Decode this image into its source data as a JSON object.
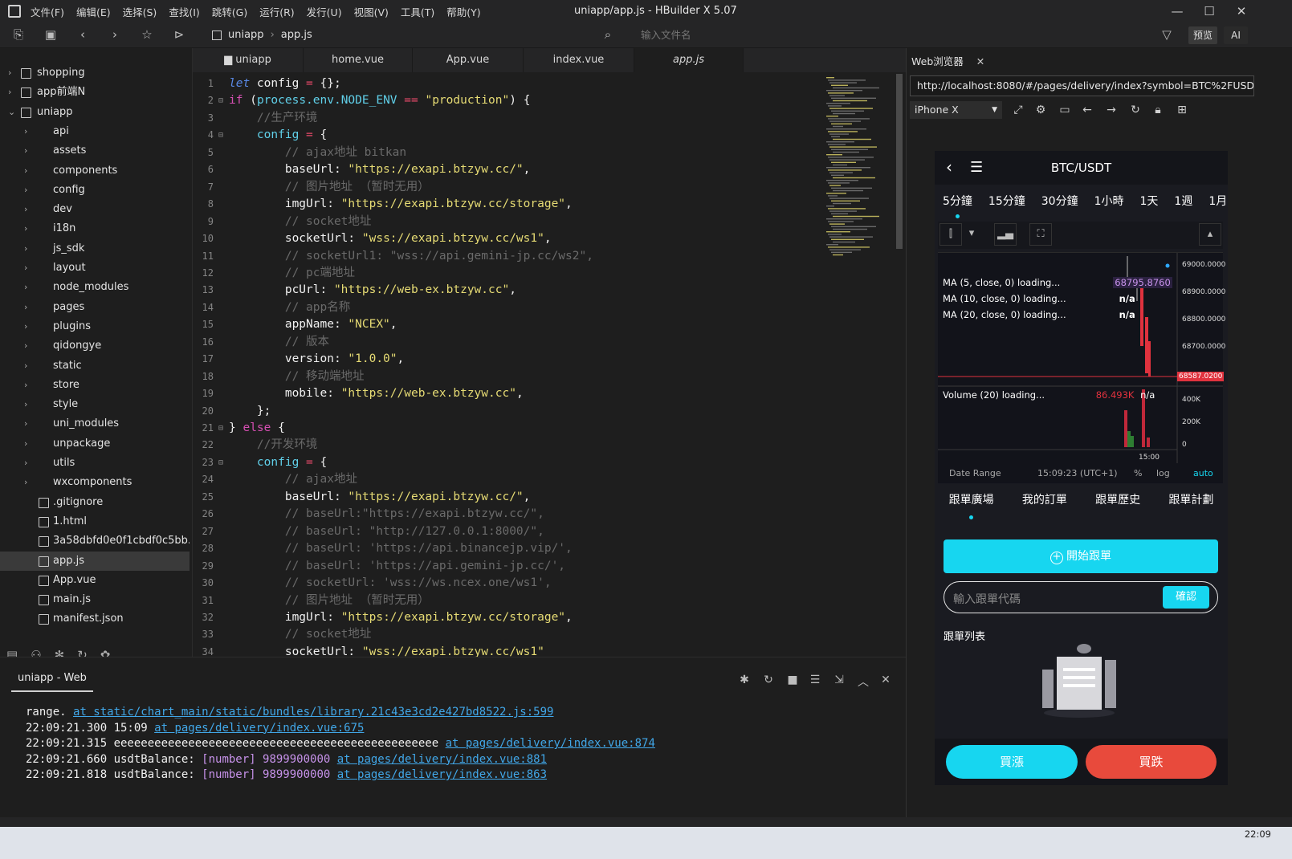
{
  "window": {
    "title": "uniapp/app.js - HBuilder X 5.07",
    "menu": [
      "文件(F)",
      "编辑(E)",
      "选择(S)",
      "查找(I)",
      "跳转(G)",
      "运行(R)",
      "发行(U)",
      "视图(V)",
      "工具(T)",
      "帮助(Y)"
    ]
  },
  "toolbar": {
    "breadcrumb": [
      "uniapp",
      "app.js"
    ],
    "file_search_placeholder": "输入文件名",
    "preview_label": "预览",
    "ai_label": "AI"
  },
  "sidebar": {
    "items": [
      {
        "label": "shopping",
        "type": "project"
      },
      {
        "label": "app前端N",
        "type": "project"
      },
      {
        "label": "uniapp",
        "type": "project"
      },
      {
        "label": "api",
        "type": "folder"
      },
      {
        "label": "assets",
        "type": "folder"
      },
      {
        "label": "components",
        "type": "folder"
      },
      {
        "label": "config",
        "type": "folder"
      },
      {
        "label": "dev",
        "type": "folder"
      },
      {
        "label": "i18n",
        "type": "folder"
      },
      {
        "label": "js_sdk",
        "type": "folder"
      },
      {
        "label": "layout",
        "type": "folder"
      },
      {
        "label": "node_modules",
        "type": "folder"
      },
      {
        "label": "pages",
        "type": "folder"
      },
      {
        "label": "plugins",
        "type": "folder"
      },
      {
        "label": "qidongye",
        "type": "folder"
      },
      {
        "label": "static",
        "type": "folder"
      },
      {
        "label": "store",
        "type": "folder"
      },
      {
        "label": "style",
        "type": "folder"
      },
      {
        "label": "uni_modules",
        "type": "folder"
      },
      {
        "label": "unpackage",
        "type": "folder"
      },
      {
        "label": "utils",
        "type": "folder"
      },
      {
        "label": "wxcomponents",
        "type": "folder"
      },
      {
        "label": ".gitignore",
        "type": "file"
      },
      {
        "label": "1.html",
        "type": "html"
      },
      {
        "label": "3a58dbfd0e0f1cbdf0c5bb...",
        "type": "file"
      },
      {
        "label": "app.js",
        "type": "file"
      },
      {
        "label": "App.vue",
        "type": "file"
      },
      {
        "label": "main.js",
        "type": "file"
      },
      {
        "label": "manifest.json",
        "type": "json"
      }
    ]
  },
  "tabs": [
    "uniapp",
    "home.vue",
    "App.vue",
    "index.vue",
    "app.js"
  ],
  "code_lines": [
    {
      "n": "1",
      "fold": "",
      "parts": [
        [
          "kwi",
          "let "
        ],
        [
          "pl",
          "config "
        ],
        [
          "op",
          "= "
        ],
        [
          "pl",
          "{};"
        ]
      ]
    },
    {
      "n": "2",
      "fold": "⊟",
      "parts": [
        [
          "kw",
          "if "
        ],
        [
          "pl",
          "("
        ],
        [
          "cy",
          "process.env.NODE_ENV "
        ],
        [
          "op",
          "== "
        ],
        [
          "str",
          "\"production\""
        ],
        [
          "pl",
          ") {"
        ]
      ]
    },
    {
      "n": "3",
      "fold": "",
      "parts": [
        [
          "cmt",
          "    //生产环境"
        ]
      ]
    },
    {
      "n": "4",
      "fold": "⊟",
      "parts": [
        [
          "pl",
          "    "
        ],
        [
          "cy",
          "config "
        ],
        [
          "op",
          "= "
        ],
        [
          "pl",
          "{"
        ]
      ]
    },
    {
      "n": "5",
      "fold": "",
      "parts": [
        [
          "cmt",
          "        // ajax地址 bitkan"
        ]
      ]
    },
    {
      "n": "6",
      "fold": "",
      "parts": [
        [
          "prop",
          "        baseUrl: "
        ],
        [
          "str",
          "\"https://exapi.btzyw.cc/\""
        ],
        [
          "pl",
          ","
        ]
      ]
    },
    {
      "n": "7",
      "fold": "",
      "parts": [
        [
          "cmt",
          "        // 图片地址 （暂时无用）"
        ]
      ]
    },
    {
      "n": "8",
      "fold": "",
      "parts": [
        [
          "prop",
          "        imgUrl: "
        ],
        [
          "str",
          "\"https://exapi.btzyw.cc/storage\""
        ],
        [
          "pl",
          ","
        ]
      ]
    },
    {
      "n": "9",
      "fold": "",
      "parts": [
        [
          "cmt",
          "        // socket地址"
        ]
      ]
    },
    {
      "n": "10",
      "fold": "",
      "parts": [
        [
          "prop",
          "        socketUrl: "
        ],
        [
          "str",
          "\"wss://exapi.btzyw.cc/ws1\""
        ],
        [
          "pl",
          ","
        ]
      ]
    },
    {
      "n": "11",
      "fold": "",
      "parts": [
        [
          "cmt",
          "        // socketUrl1: \"wss://api.gemini-jp.cc/ws2\","
        ]
      ]
    },
    {
      "n": "12",
      "fold": "",
      "parts": [
        [
          "cmt",
          "        // pc端地址"
        ]
      ]
    },
    {
      "n": "13",
      "fold": "",
      "parts": [
        [
          "prop",
          "        pcUrl: "
        ],
        [
          "str",
          "\"https://web-ex.btzyw.cc\""
        ],
        [
          "pl",
          ","
        ]
      ]
    },
    {
      "n": "14",
      "fold": "",
      "parts": [
        [
          "cmt",
          "        // app名称"
        ]
      ]
    },
    {
      "n": "15",
      "fold": "",
      "parts": [
        [
          "prop",
          "        appName: "
        ],
        [
          "str",
          "\"NCEX\""
        ],
        [
          "pl",
          ","
        ]
      ]
    },
    {
      "n": "16",
      "fold": "",
      "parts": [
        [
          "cmt",
          "        // 版本"
        ]
      ]
    },
    {
      "n": "17",
      "fold": "",
      "parts": [
        [
          "prop",
          "        version: "
        ],
        [
          "str",
          "\"1.0.0\""
        ],
        [
          "pl",
          ","
        ]
      ]
    },
    {
      "n": "18",
      "fold": "",
      "parts": [
        [
          "cmt",
          "        // 移动端地址"
        ]
      ]
    },
    {
      "n": "19",
      "fold": "",
      "parts": [
        [
          "prop",
          "        mobile: "
        ],
        [
          "str",
          "\"https://web-ex.btzyw.cc\""
        ],
        [
          "pl",
          ","
        ]
      ]
    },
    {
      "n": "20",
      "fold": "",
      "parts": [
        [
          "pl",
          "    };"
        ]
      ]
    },
    {
      "n": "21",
      "fold": "⊟",
      "parts": [
        [
          "pl",
          "} "
        ],
        [
          "kw",
          "else "
        ],
        [
          "pl",
          "{"
        ]
      ]
    },
    {
      "n": "22",
      "fold": "",
      "parts": [
        [
          "cmt",
          "    //开发环境"
        ]
      ]
    },
    {
      "n": "23",
      "fold": "⊟",
      "parts": [
        [
          "pl",
          "    "
        ],
        [
          "cy",
          "config "
        ],
        [
          "op",
          "= "
        ],
        [
          "pl",
          "{"
        ]
      ]
    },
    {
      "n": "24",
      "fold": "",
      "parts": [
        [
          "cmt",
          "        // ajax地址"
        ]
      ]
    },
    {
      "n": "25",
      "fold": "",
      "parts": [
        [
          "prop",
          "        baseUrl: "
        ],
        [
          "str",
          "\"https://exapi.btzyw.cc/\""
        ],
        [
          "pl",
          ","
        ]
      ]
    },
    {
      "n": "26",
      "fold": "",
      "parts": [
        [
          "cmt",
          "        // baseUrl:\"https://exapi.btzyw.cc/\","
        ]
      ]
    },
    {
      "n": "27",
      "fold": "",
      "parts": [
        [
          "cmt",
          "        // baseUrl: \"http://127.0.0.1:8000/\","
        ]
      ]
    },
    {
      "n": "28",
      "fold": "",
      "parts": [
        [
          "cmt",
          "        // baseUrl: 'https://api.binancejp.vip/',"
        ]
      ]
    },
    {
      "n": "29",
      "fold": "",
      "parts": [
        [
          "cmt",
          "        // baseUrl: 'https://api.gemini-jp.cc/',"
        ]
      ]
    },
    {
      "n": "30",
      "fold": "",
      "parts": [
        [
          "cmt",
          "        // socketUrl: 'wss://ws.ncex.one/ws1',"
        ]
      ]
    },
    {
      "n": "31",
      "fold": "",
      "parts": [
        [
          "cmt",
          "        // 图片地址 （暂时无用）"
        ]
      ]
    },
    {
      "n": "32",
      "fold": "",
      "parts": [
        [
          "prop",
          "        imgUrl: "
        ],
        [
          "str",
          "\"https://exapi.btzyw.cc/storage\""
        ],
        [
          "pl",
          ","
        ]
      ]
    },
    {
      "n": "33",
      "fold": "",
      "parts": [
        [
          "cmt",
          "        // socket地址"
        ]
      ]
    },
    {
      "n": "34",
      "fold": "",
      "parts": [
        [
          "prop",
          "        socketUrl: "
        ],
        [
          "str",
          "\"wss://exapi.btzyw.cc/ws1\""
        ]
      ]
    }
  ],
  "console": {
    "tab_label": "uniapp - Web",
    "lines": [
      [
        [
          "pl",
          "range. "
        ],
        [
          "lnk",
          "at static/chart_main/static/bundles/library.21c43e3cd2e427bd8522.js:599"
        ]
      ],
      [
        [
          "pl",
          "22:09:21.300 15:09 "
        ],
        [
          "lnk",
          "at pages/delivery/index.vue:675"
        ]
      ],
      [
        [
          "pl",
          "22:09:21.315 eeeeeeeeeeeeeeeeeeeeeeeeeeeeeeeeeeeeeeeeeeeeeeee "
        ],
        [
          "lnk",
          "at pages/delivery/index.vue:874"
        ]
      ],
      [
        [
          "pl",
          "22:09:21.660 usdtBalance: "
        ],
        [
          "num",
          "[number] 9899900000 "
        ],
        [
          "lnk",
          "at pages/delivery/index.vue:881"
        ]
      ],
      [
        [
          "pl",
          "22:09:21.818 usdtBalance: "
        ],
        [
          "num",
          "[number] 9899900000 "
        ],
        [
          "lnk",
          "at pages/delivery/index.vue:863"
        ]
      ]
    ]
  },
  "browser": {
    "tab_label": "Web浏览器",
    "url": "http://localhost:8080/#/pages/delivery/index?symbol=BTC%2FUSDT",
    "device": "iPhone X"
  },
  "phone": {
    "pair": "BTC/USDT",
    "timeframes": [
      "5分鐘",
      "15分鐘",
      "30分鐘",
      "1小時",
      "1天",
      "1週",
      "1月"
    ],
    "ma_rows": [
      {
        "label": "MA (5, close, 0) loading...",
        "value": "68795.8760"
      },
      {
        "label": "MA (10, close, 0) loading...",
        "value": "n/a"
      },
      {
        "label": "MA (20, close, 0) loading...",
        "value": "n/a"
      }
    ],
    "price_ticks": [
      "69000.0000",
      "68900.0000",
      "68800.0000",
      "68700.0000"
    ],
    "last_price": "68587.0200",
    "volume_label": "Volume (20) loading...",
    "volume_value": "86.493K",
    "volume_na": "n/a",
    "volume_ticks": [
      "400K",
      "200K",
      "0"
    ],
    "time_tick": "15:00",
    "date_range_label": "Date Range",
    "clock_utc": "15:09:23 (UTC+1)",
    "pct": "%",
    "log": "log",
    "auto": "auto",
    "tabs": [
      "跟單廣場",
      "我的訂單",
      "跟單歷史",
      "跟單計劃"
    ],
    "start_label": "開始跟單",
    "code_placeholder": "輸入跟單代碼",
    "confirm_label": "確認",
    "list_title": "跟單列表",
    "buy_up": "買漲",
    "buy_down": "買跌",
    "accent": "#17d6f0",
    "down_color": "#e84a3c"
  },
  "taskbar": {
    "time": "22:09"
  }
}
